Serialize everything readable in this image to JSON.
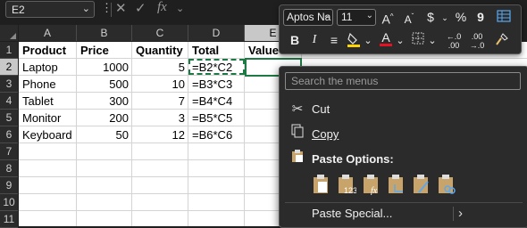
{
  "formula_bar": {
    "name_box": "E2",
    "fx_label": "fx"
  },
  "columns": [
    "A",
    "B",
    "C",
    "D",
    "E"
  ],
  "rows": [
    "1",
    "2",
    "3",
    "4",
    "5",
    "6",
    "7",
    "8",
    "9",
    "10",
    "11"
  ],
  "sheet": {
    "headers": {
      "A1": "Product",
      "B1": "Price",
      "C1": "Quantity",
      "D1": "Total",
      "E1": "Values"
    },
    "data": [
      {
        "A": "Laptop",
        "B": "1000",
        "C": "5",
        "D": "=B2*C2"
      },
      {
        "A": "Phone",
        "B": "500",
        "C": "10",
        "D": "=B3*C3"
      },
      {
        "A": "Tablet",
        "B": "300",
        "C": "7",
        "D": "=B4*C4"
      },
      {
        "A": "Monitor",
        "B": "200",
        "C": "3",
        "D": "=B5*C5"
      },
      {
        "A": "Keyboard",
        "B": "50",
        "C": "12",
        "D": "=B6*C6"
      }
    ]
  },
  "mini_toolbar": {
    "font_name": "Aptos Na",
    "font_size": "11",
    "bold": "B",
    "italic": "I",
    "currency": "$",
    "percent": "%",
    "comma": "9",
    "increase_font": "A",
    "decrease_font": "A",
    "font_color_letter": "A",
    "decimals_up": ".00",
    "decimals_down": ".00",
    "accent_fill": "#ffd400",
    "accent_font": "#e81123"
  },
  "context_menu": {
    "search_placeholder": "Search the menus",
    "cut": "Cut",
    "copy": "Copy",
    "paste_options": "Paste Options:",
    "paste_special": "Paste Special...",
    "paste_special_arrow": "›"
  },
  "colors": {
    "selection_green": "#1e7a44",
    "menu_bg": "#2b2b2b"
  }
}
